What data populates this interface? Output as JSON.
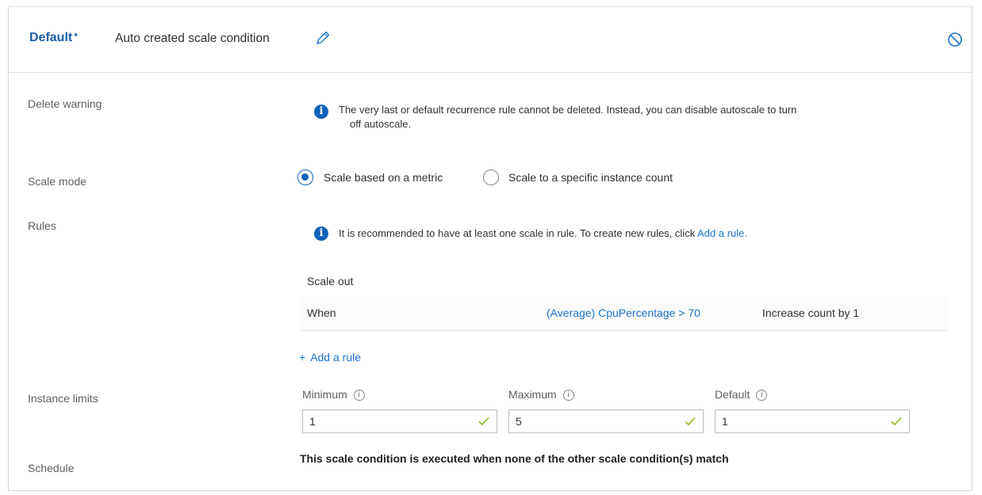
{
  "header": {
    "title": "Default",
    "required_mark": "*",
    "condition_name": "Auto created scale condition"
  },
  "delete_warning": {
    "label": "Delete warning",
    "message_line1": "The very last or default recurrence rule cannot be deleted. Instead, you can disable autoscale to turn",
    "message_line2": "off autoscale."
  },
  "scale_mode": {
    "label": "Scale mode",
    "options": [
      {
        "label": "Scale based on a metric",
        "selected": true
      },
      {
        "label": "Scale to a specific instance count",
        "selected": false
      }
    ]
  },
  "rules": {
    "label": "Rules",
    "info_text": "It is recommended to have at least one scale in rule. To create new rules, click ",
    "info_link": "Add a rule.",
    "table_header": "Scale out",
    "rows": [
      {
        "when": "When",
        "metric": "(Average) CpuPercentage > 70",
        "action": "Increase count by 1"
      }
    ],
    "add_rule": "Add a rule"
  },
  "instance_limits": {
    "label": "Instance limits",
    "minimum": {
      "label": "Minimum",
      "value": "1"
    },
    "maximum": {
      "label": "Maximum",
      "value": "5"
    },
    "default": {
      "label": "Default",
      "value": "1"
    }
  },
  "schedule": {
    "label": "Schedule",
    "text": "This scale condition is executed when none of the other scale condition(s) match"
  },
  "colors": {
    "accent": "#0f63b8",
    "link": "#1a73c9",
    "valid_check": "#8cbd18"
  }
}
